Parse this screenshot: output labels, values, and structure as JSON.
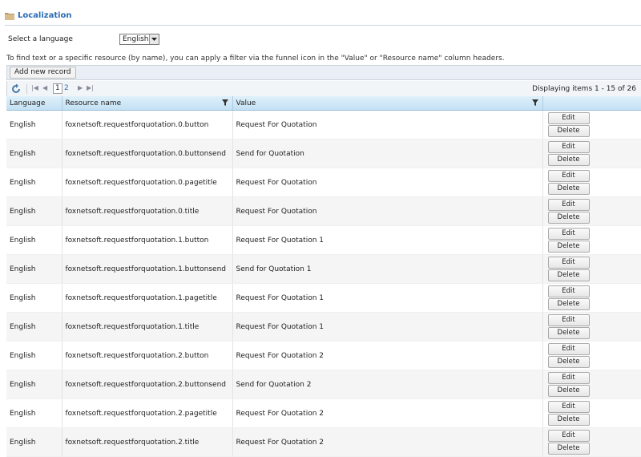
{
  "header": {
    "title": "Localization"
  },
  "language": {
    "label": "Select a language",
    "selected": "English"
  },
  "hint": "To find text or a specific resource (by name), you can apply a filter via the funnel icon in the \"Value\" or \"Resource name\" column headers.",
  "toolbar": {
    "add_label": "Add new record"
  },
  "pager": {
    "current_page": "1",
    "next_page": "2",
    "info": "Displaying items 1 - 15 of 26"
  },
  "columns": {
    "language": "Language",
    "resource": "Resource name",
    "value": "Value"
  },
  "actions": {
    "edit": "Edit",
    "delete": "Delete"
  },
  "rows": [
    {
      "language": "English",
      "resource": "foxnetsoft.requestforquotation.0.button",
      "value": "Request For Quotation"
    },
    {
      "language": "English",
      "resource": "foxnetsoft.requestforquotation.0.buttonsend",
      "value": "Send for Quotation"
    },
    {
      "language": "English",
      "resource": "foxnetsoft.requestforquotation.0.pagetitle",
      "value": "Request For Quotation"
    },
    {
      "language": "English",
      "resource": "foxnetsoft.requestforquotation.0.title",
      "value": "Request For Quotation"
    },
    {
      "language": "English",
      "resource": "foxnetsoft.requestforquotation.1.button",
      "value": "Request For Quotation 1"
    },
    {
      "language": "English",
      "resource": "foxnetsoft.requestforquotation.1.buttonsend",
      "value": "Send for Quotation 1"
    },
    {
      "language": "English",
      "resource": "foxnetsoft.requestforquotation.1.pagetitle",
      "value": "Request For Quotation 1"
    },
    {
      "language": "English",
      "resource": "foxnetsoft.requestforquotation.1.title",
      "value": "Request For Quotation 1"
    },
    {
      "language": "English",
      "resource": "foxnetsoft.requestforquotation.2.button",
      "value": "Request For Quotation 2"
    },
    {
      "language": "English",
      "resource": "foxnetsoft.requestforquotation.2.buttonsend",
      "value": "Send for Quotation 2"
    },
    {
      "language": "English",
      "resource": "foxnetsoft.requestforquotation.2.pagetitle",
      "value": "Request For Quotation 2"
    },
    {
      "language": "English",
      "resource": "foxnetsoft.requestforquotation.2.title",
      "value": "Request For Quotation 2"
    }
  ]
}
